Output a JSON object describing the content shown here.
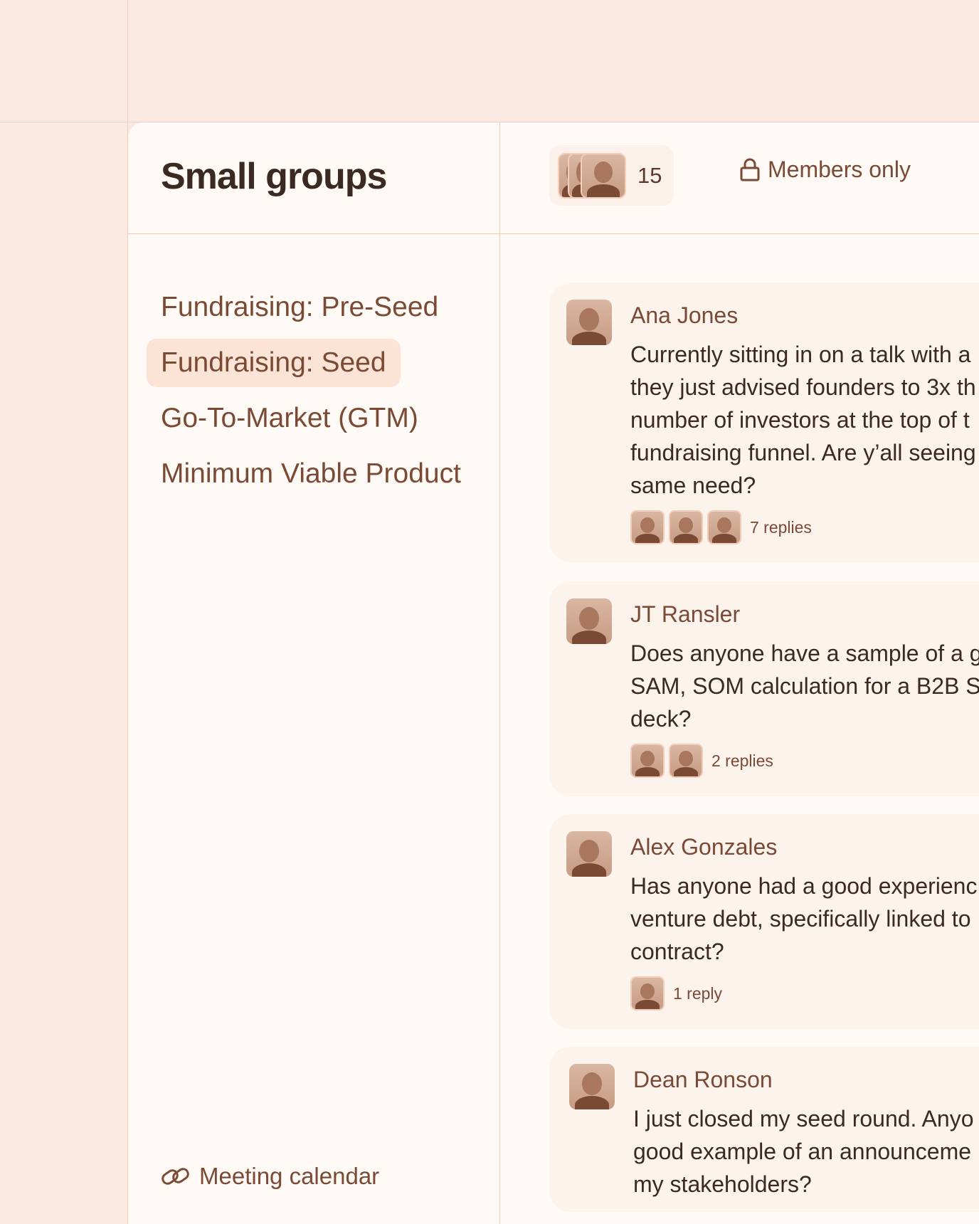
{
  "page": {
    "title": "Small groups"
  },
  "colors": {
    "background": "#fbeae1",
    "panel": "#fffaf6",
    "card": "#fcf3ed",
    "accent_text": "#7a4a35",
    "selected": "#fbe3d6"
  },
  "header": {
    "member_count": "15",
    "visibility": "Members only",
    "visibility_icon": "lock-icon"
  },
  "sidebar": {
    "items": [
      {
        "label": "Fundraising: Pre-Seed",
        "selected": false
      },
      {
        "label": "Fundraising: Seed",
        "selected": true
      },
      {
        "label": "Go-To-Market (GTM)",
        "selected": false
      },
      {
        "label": "Minimum Viable Product",
        "selected": false
      }
    ],
    "footer_link": {
      "label": "Meeting calendar",
      "icon": "link-icon"
    }
  },
  "posts": [
    {
      "author": "Ana Jones",
      "lines": [
        "Currently sitting in on a talk with a",
        "they just advised founders to 3x th",
        "number of investors at the top of t",
        "fundraising funnel. Are y’all seeing",
        "same need?"
      ],
      "replies": "7 replies"
    },
    {
      "author": "JT Ransler",
      "lines": [
        "Does anyone have a sample of a g",
        "SAM, SOM calculation for a B2B S",
        "deck?"
      ],
      "replies": "2 replies"
    },
    {
      "author": "Alex Gonzales",
      "lines": [
        "Has anyone had a good experienc",
        "venture debt, specifically linked to",
        "contract?"
      ],
      "replies": "1 reply"
    },
    {
      "author": "Dean Ronson",
      "lines": [
        "I just closed my seed round. Anyo",
        "good example of an announceme",
        "my stakeholders?"
      ]
    }
  ]
}
